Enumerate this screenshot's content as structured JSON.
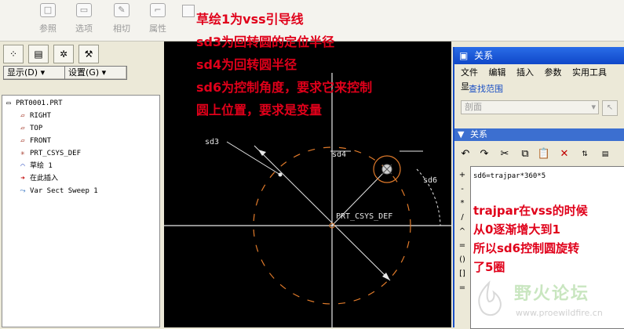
{
  "toolbar": {
    "buttons": [
      {
        "label": "参照",
        "icon": "square-icon"
      },
      {
        "label": "选项",
        "icon": "speech-icon"
      },
      {
        "label": "相切",
        "icon": "edit-icon"
      },
      {
        "label": "属性",
        "icon": "corner-icon"
      }
    ]
  },
  "left_panel": {
    "show_label": "显示(D)",
    "settings_label": "设置(G)",
    "tree": [
      {
        "label": "PRT0001.PRT",
        "icon": "part-icon"
      },
      {
        "label": "RIGHT",
        "icon": "datum-plane-icon"
      },
      {
        "label": "TOP",
        "icon": "datum-plane-icon"
      },
      {
        "label": "FRONT",
        "icon": "datum-plane-icon"
      },
      {
        "label": "PRT_CSYS_DEF",
        "icon": "csys-icon"
      },
      {
        "label": "草绘 1",
        "icon": "sketch-icon"
      },
      {
        "label": "在此插入",
        "icon": "insert-arrow-icon"
      },
      {
        "label": "Var Sect Sweep 1",
        "icon": "sweep-icon"
      }
    ]
  },
  "canvas": {
    "labels": {
      "sd3": "sd3",
      "sd4": "sd4",
      "sd6": "sd6",
      "csys": "PRT_CSYS_DEF"
    }
  },
  "annotations": {
    "top": [
      "草绘1为vss引导线",
      "sd3为回转圆的定位半径",
      "sd4为回转圆半径",
      "sd6为控制角度，要求它来控制",
      "圆上位置，要求是变量"
    ],
    "right": [
      "trajpar在vss的时候",
      "从0逐渐增大到1",
      "所以sd6控制圆旋转",
      "了5圈"
    ]
  },
  "dialog": {
    "title": "关系",
    "menu": [
      "文件",
      "编辑",
      "插入",
      "参数",
      "实用工具",
      "显"
    ],
    "scope_title": "查找范围",
    "scope_value": "剖面",
    "relations_title": "关系",
    "operators": [
      "+",
      "-",
      "*",
      "/",
      "^",
      "=",
      "()",
      "[]",
      "="
    ],
    "relation": "sd6=trajpar*360*5"
  },
  "watermark": {
    "name": "野火论坛",
    "url": "www.proewildfire.cn"
  },
  "colors": {
    "annotation": "#e0001a",
    "dialog_title": "#1a5ad8",
    "canvas_bg": "#000000",
    "sketch_dash": "#e07a2a"
  }
}
